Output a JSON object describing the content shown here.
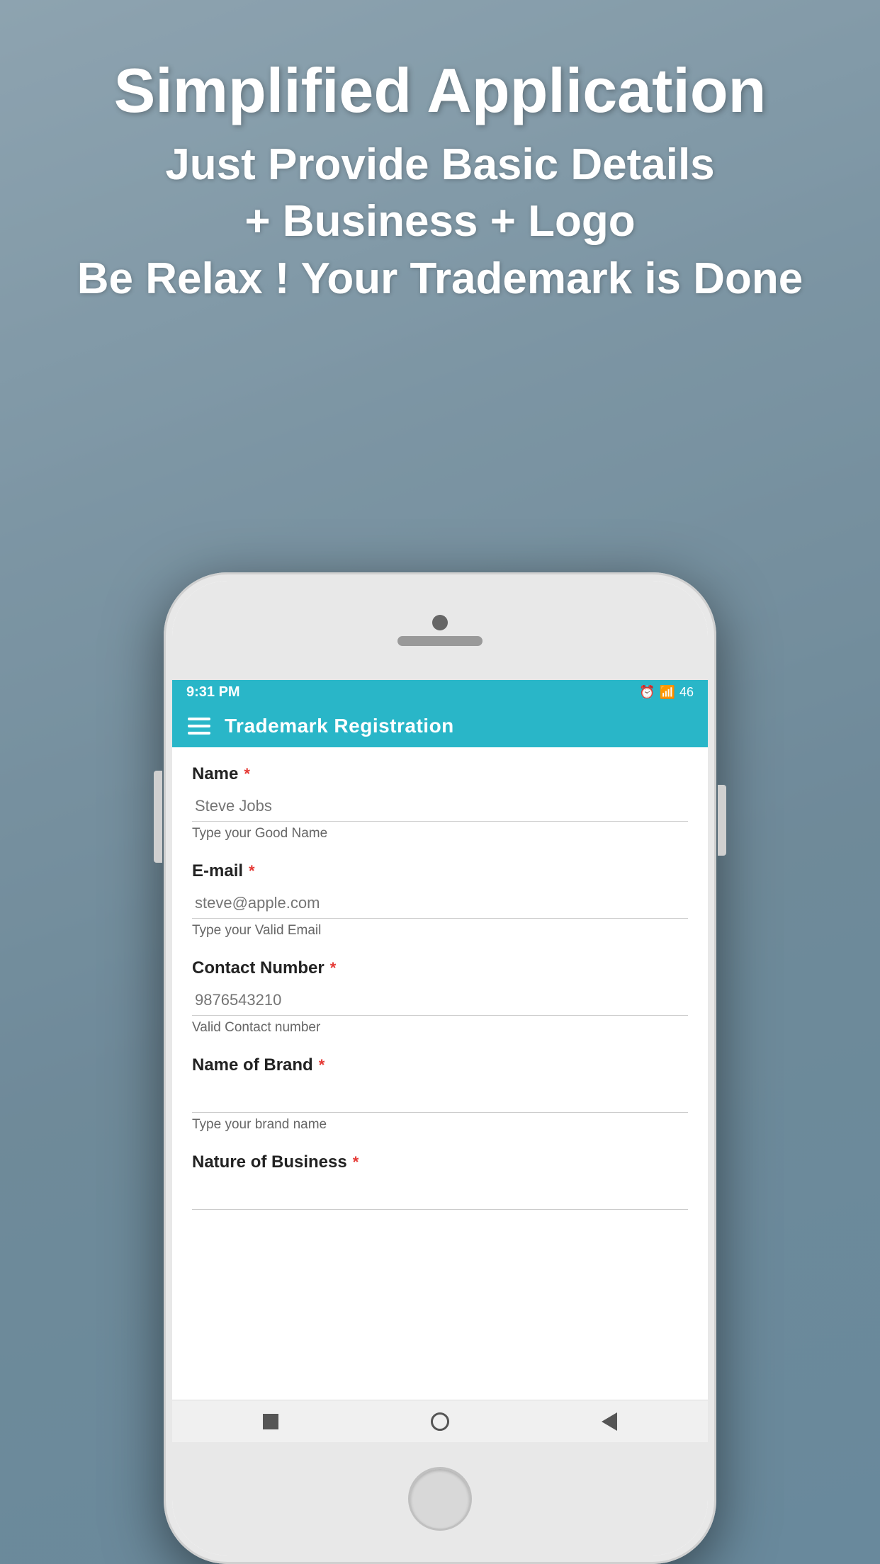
{
  "background": {
    "color": "#90a4ae"
  },
  "hero": {
    "title": "Simplified Application",
    "line1": "Just Provide Basic Details",
    "line2": "+ Business + Logo",
    "line3": "Be Relax ! Your Trademark is Done"
  },
  "phone": {
    "status_bar": {
      "time": "9:31 PM",
      "icons": "⏰ 🔔 📶 46"
    },
    "app_bar": {
      "title": "Trademark Registration"
    },
    "form": {
      "fields": [
        {
          "label": "Name",
          "required": true,
          "placeholder": "Steve Jobs",
          "hint": "Type your Good Name",
          "input_name": "name-input"
        },
        {
          "label": "E-mail",
          "required": true,
          "placeholder": "steve@apple.com",
          "hint": "Type your Valid Email",
          "input_name": "email-input"
        },
        {
          "label": "Contact Number",
          "required": true,
          "placeholder": "9876543210",
          "hint": "Valid Contact number",
          "input_name": "contact-input"
        },
        {
          "label": "Name of Brand",
          "required": true,
          "placeholder": "",
          "hint": "Type your brand name",
          "input_name": "brand-input"
        },
        {
          "label": "Nature of Business",
          "required": true,
          "placeholder": "",
          "hint": "",
          "input_name": "business-input"
        }
      ]
    },
    "navbar": {
      "stop_label": "stop",
      "home_label": "home",
      "back_label": "back"
    }
  }
}
